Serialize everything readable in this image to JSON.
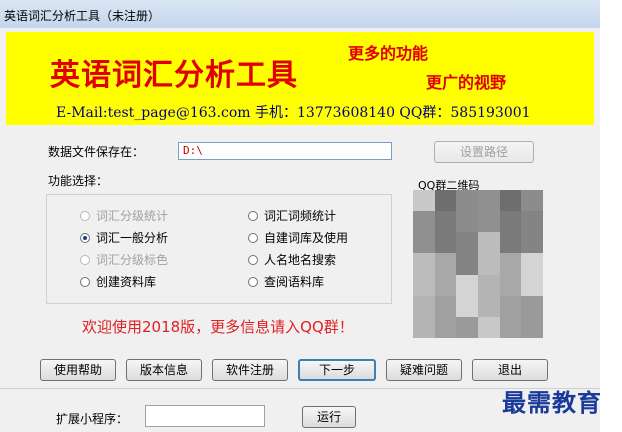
{
  "window": {
    "title": "英语词汇分析工具（未注册）"
  },
  "banner": {
    "title": "英语词汇分析工具",
    "slogan_1": "更多的功能",
    "slogan_2": "更广的视野",
    "contact": "E-Mail:test_page@163.com  手机：13773608140  QQ群：585193001"
  },
  "save_path": {
    "label": "数据文件保存在：",
    "value": "D:\\",
    "button": "设置路径"
  },
  "functions": {
    "label": "功能选择：",
    "options": [
      {
        "label": "词汇分级统计",
        "enabled": false,
        "checked": false
      },
      {
        "label": "词汇词频统计",
        "enabled": true,
        "checked": false
      },
      {
        "label": "词汇一般分析",
        "enabled": true,
        "checked": true
      },
      {
        "label": "自建词库及使用",
        "enabled": true,
        "checked": false
      },
      {
        "label": "词汇分级标色",
        "enabled": false,
        "checked": false
      },
      {
        "label": "人名地名搜索",
        "enabled": true,
        "checked": false
      },
      {
        "label": "创建资料库",
        "enabled": true,
        "checked": false
      },
      {
        "label": "查阅语料库",
        "enabled": true,
        "checked": false
      }
    ]
  },
  "qr": {
    "label": "QQ群二维码"
  },
  "welcome": "欢迎使用2018版，更多信息请入QQ群！",
  "buttons": {
    "help": "使用帮助",
    "version": "版本信息",
    "register": "软件注册",
    "next": "下一步",
    "faq": "疑难问题",
    "exit": "退出"
  },
  "extension": {
    "label": "扩展小程序：",
    "value": "",
    "run_button": "运行"
  },
  "watermark": "最需教育",
  "colors": {
    "banner_bg": "#ffff00",
    "banner_text": "#e00000",
    "contact_text": "#000080",
    "welcome_text": "#e02020"
  }
}
